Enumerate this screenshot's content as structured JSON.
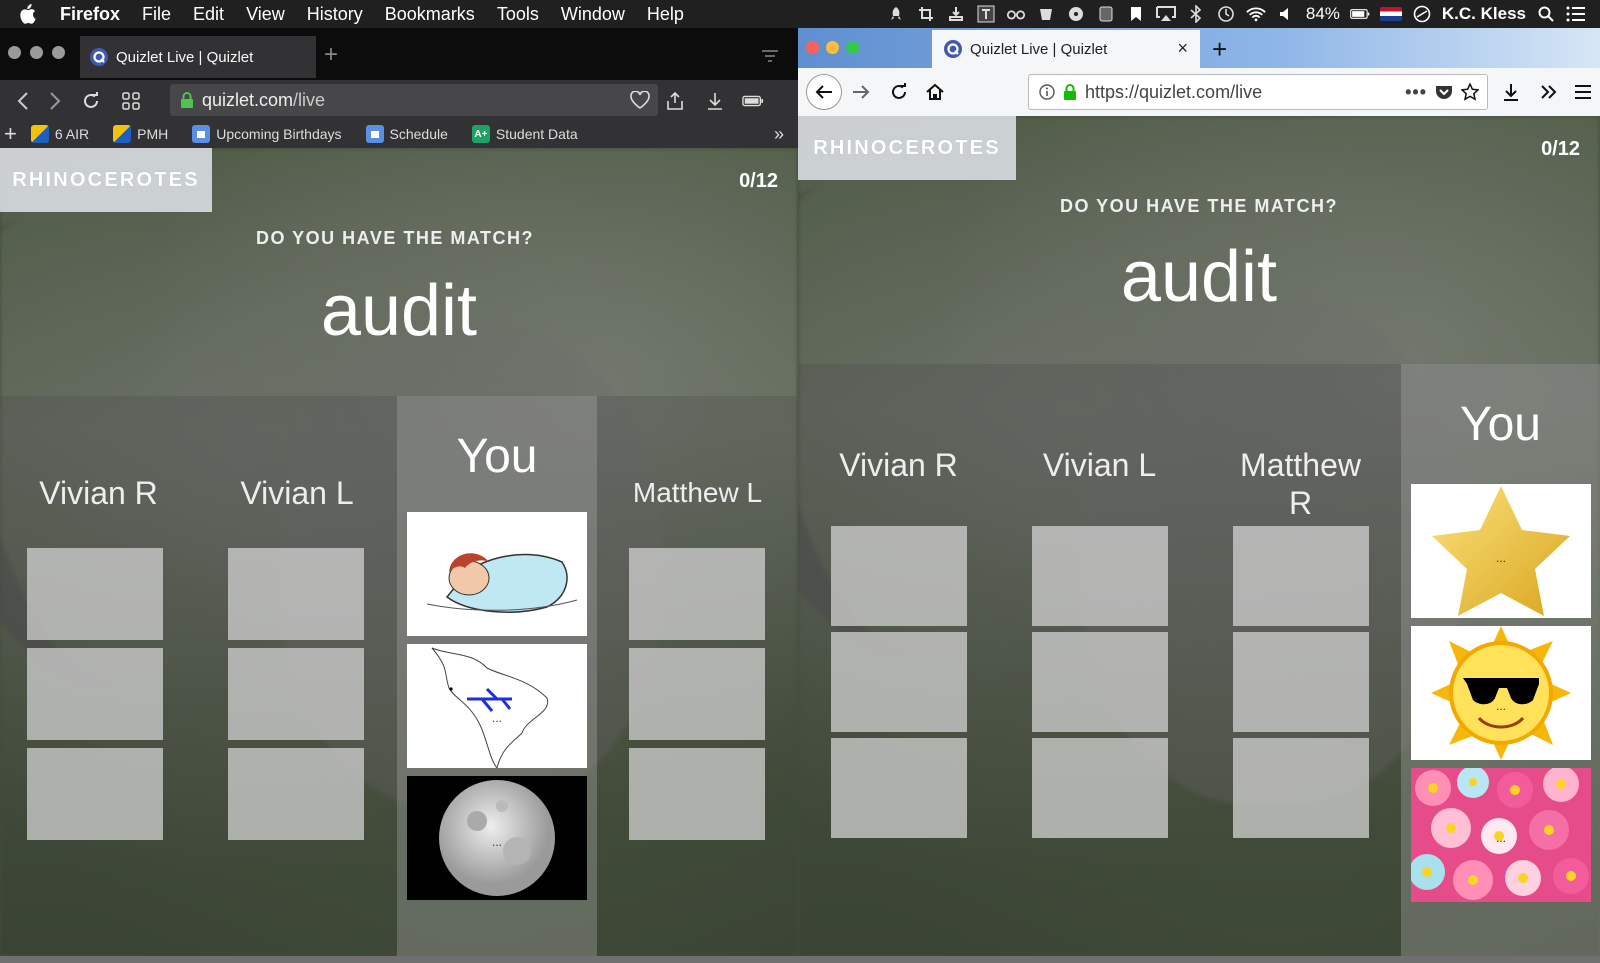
{
  "menubar": {
    "app": "Firefox",
    "menus": [
      "File",
      "Edit",
      "View",
      "History",
      "Bookmarks",
      "Tools",
      "Window",
      "Help"
    ],
    "battery": "84%",
    "user": "K.C. Kless"
  },
  "left_window": {
    "tab_title": "Quizlet Live | Quizlet",
    "url_host": "quizlet.com",
    "url_path": "/live",
    "bookmarks": [
      "6 AIR",
      "PMH",
      "Upcoming Birthdays",
      "Schedule",
      "Student Data"
    ],
    "game": {
      "team": "RHINOCEROTES",
      "score": "0/12",
      "prompt": "DO YOU HAVE THE MATCH?",
      "term": "audit",
      "players": [
        "Vivian R",
        "Vivian L",
        "You",
        "Matthew L"
      ],
      "ellipsis": "..."
    }
  },
  "right_window": {
    "tab_title": "Quizlet Live | Quizlet",
    "tab_close": "×",
    "new_tab": "+",
    "url": "https://quizlet.com/live",
    "game": {
      "team": "RHINOCEROTES",
      "score": "0/12",
      "prompt": "DO YOU HAVE THE MATCH?",
      "term": "audit",
      "players": [
        "Vivian R",
        "Vivian L",
        "Matthew R",
        "You"
      ],
      "ellipsis": "..."
    }
  }
}
